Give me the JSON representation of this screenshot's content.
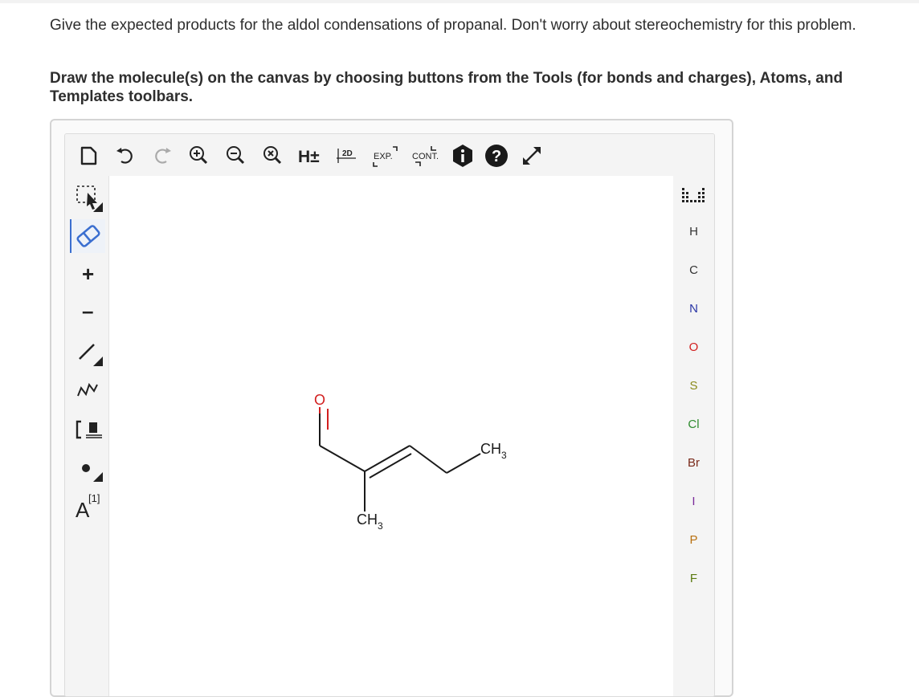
{
  "question": {
    "line1": "Give the expected products for the aldol condensations of propanal. Don't worry about stereochemistry for this problem.",
    "line2": "Draw the molecule(s) on the canvas by choosing buttons from the Tools (for bonds and charges), Atoms, and Templates toolbars."
  },
  "toolbar": {
    "h_label": "H±",
    "two_d_label": "2D",
    "exp_label": "EXP.",
    "cont_label": "CONT."
  },
  "left_tools": {
    "plus": "+",
    "minus": "–",
    "charge_label": "A",
    "charge_sup": "[1]"
  },
  "atoms": [
    {
      "symbol": "H",
      "color": "#333333"
    },
    {
      "symbol": "C",
      "color": "#333333"
    },
    {
      "symbol": "N",
      "color": "#2a36a6"
    },
    {
      "symbol": "O",
      "color": "#d21f1f"
    },
    {
      "symbol": "S",
      "color": "#8a8a1a"
    },
    {
      "symbol": "Cl",
      "color": "#2e8b2e"
    },
    {
      "symbol": "Br",
      "color": "#7a2a1a"
    },
    {
      "symbol": "I",
      "color": "#7b2a9a"
    },
    {
      "symbol": "P",
      "color": "#b8700f"
    },
    {
      "symbol": "F",
      "color": "#5a7a10"
    }
  ],
  "molecule": {
    "oxygen": "O",
    "methyl_right": "CH",
    "methyl_right_sub": "3",
    "methyl_bottom": "CH",
    "methyl_bottom_sub": "3",
    "colors": {
      "oxygen": "#d21f1f",
      "bond": "#1a1a1a"
    }
  },
  "accent": "#3b6fd0"
}
